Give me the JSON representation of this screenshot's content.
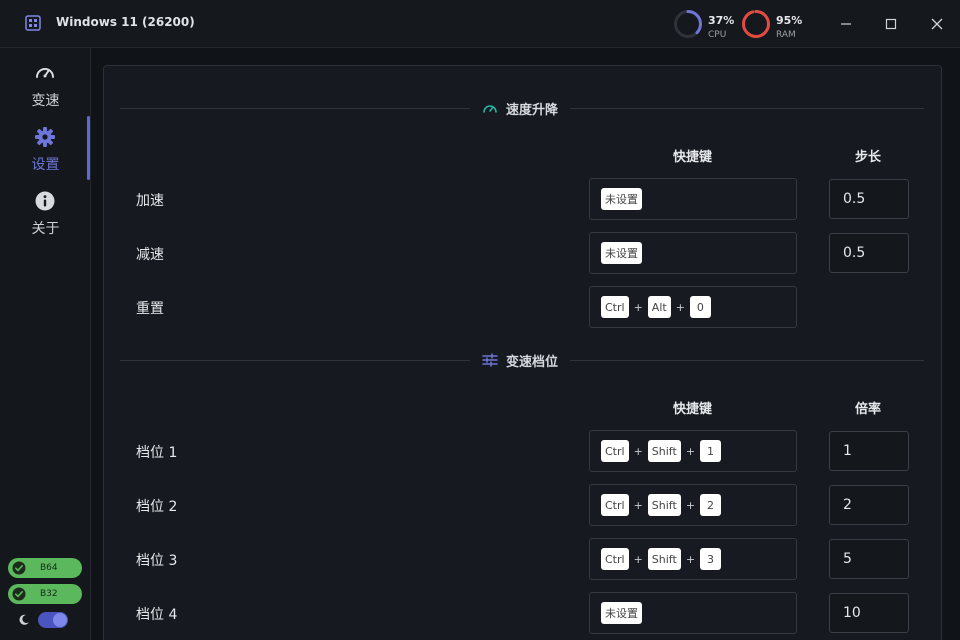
{
  "window": {
    "title": "Windows 11 (26200)",
    "cpu": {
      "percent_text": "37%",
      "label": "CPU",
      "fraction": 0.37,
      "color": "#6e76d6"
    },
    "ram": {
      "percent_text": "95%",
      "label": "RAM",
      "fraction": 0.95,
      "color": "#e34b40"
    }
  },
  "sidebar": {
    "items": [
      {
        "label": "变速",
        "icon": "speedometer-icon"
      },
      {
        "label": "设置",
        "icon": "gear-icon",
        "active": true
      },
      {
        "label": "关于",
        "icon": "info-icon"
      }
    ],
    "badges": [
      {
        "label": "B64"
      },
      {
        "label": "B32"
      }
    ],
    "theme_toggle": {
      "icon": "moon-icon",
      "on": true
    }
  },
  "speed_section": {
    "title": "速度升降",
    "icon": "speedometer-icon",
    "col_hotkey": "快捷键",
    "col_step": "步长",
    "rows": [
      {
        "label": "加速",
        "keys": [
          "未设置"
        ],
        "value": "0.5"
      },
      {
        "label": "减速",
        "keys": [
          "未设置"
        ],
        "value": "0.5"
      },
      {
        "label": "重置",
        "keys": [
          "Ctrl",
          "Alt",
          "0"
        ]
      }
    ]
  },
  "gear_section": {
    "title": "变速档位",
    "icon": "sliders-icon",
    "col_hotkey": "快捷键",
    "col_rate": "倍率",
    "rows": [
      {
        "label": "档位 1",
        "keys": [
          "Ctrl",
          "Shift",
          "1"
        ],
        "value": "1"
      },
      {
        "label": "档位 2",
        "keys": [
          "Ctrl",
          "Shift",
          "2"
        ],
        "value": "2"
      },
      {
        "label": "档位 3",
        "keys": [
          "Ctrl",
          "Shift",
          "3"
        ],
        "value": "5"
      },
      {
        "label": "档位 4",
        "keys": [
          "未设置"
        ],
        "value": "10"
      }
    ]
  },
  "plus_sign": "+",
  "colors": {
    "accent": "#5f69d4",
    "teal": "#2bb3a3",
    "badge_green": "#5cb85c"
  }
}
